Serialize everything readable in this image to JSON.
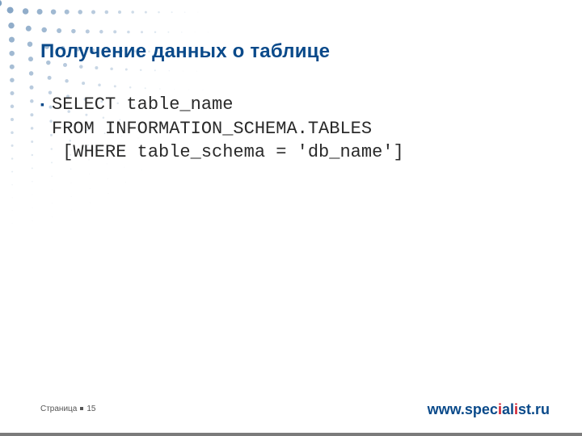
{
  "title": "Получение данных о таблице",
  "bullet_glyph": "▪",
  "code": {
    "line1": "SELECT table_name",
    "line2": "FROM INFORMATION_SCHEMA.TABLES",
    "line3": " [WHERE table_schema = 'db_name']"
  },
  "footer": {
    "page_label": "Страница",
    "page_number": "15",
    "site_prefix": "www.spec",
    "site_i": "i",
    "site_mid": "al",
    "site_i2": "i",
    "site_suffix": "st.ru"
  },
  "colors": {
    "brand": "#0a4a8a",
    "accent": "#d02030"
  }
}
